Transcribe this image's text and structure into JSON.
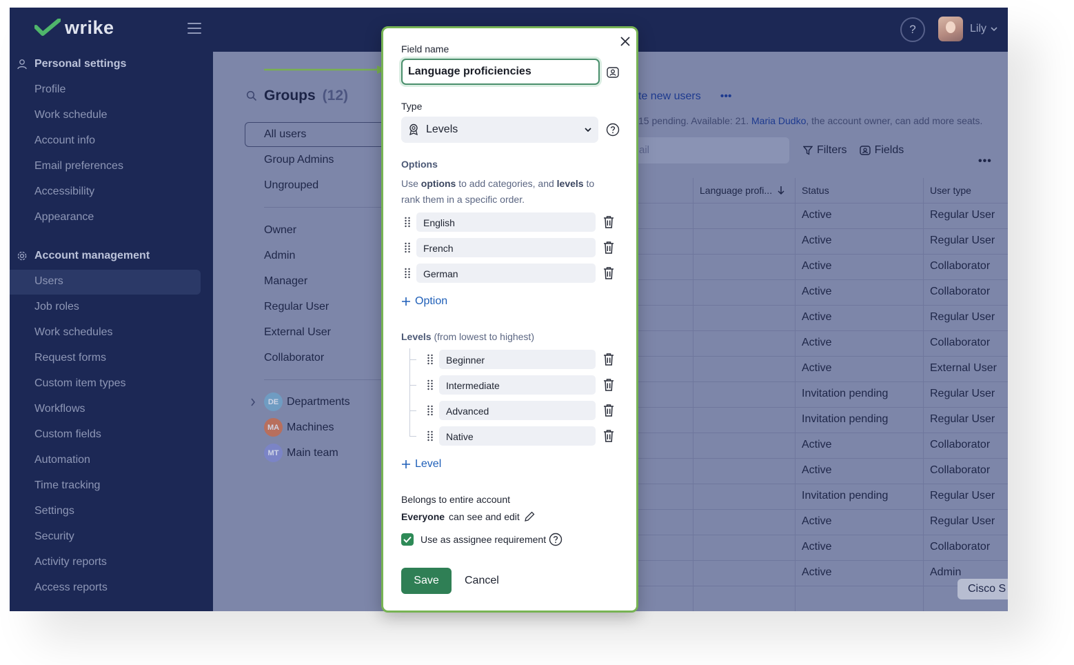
{
  "brand": {
    "name": "wrike"
  },
  "topbar": {
    "user_name": "Lily",
    "help": "?"
  },
  "sidebar": {
    "personal_header": "Personal settings",
    "personal_items": [
      "Profile",
      "Work schedule",
      "Account info",
      "Email preferences",
      "Accessibility",
      "Appearance"
    ],
    "account_header": "Account management",
    "account_items": [
      "Users",
      "Job roles",
      "Work schedules",
      "Request forms",
      "Custom item types",
      "Workflows",
      "Custom fields",
      "Automation",
      "Time tracking",
      "Settings",
      "Security",
      "Activity reports",
      "Access reports"
    ]
  },
  "groups": {
    "title": "Groups",
    "count": "(12)",
    "items": [
      "All users",
      "Group Admins",
      "Ungrouped"
    ],
    "roles": [
      "Owner",
      "Admin",
      "Manager",
      "Regular User",
      "External User",
      "Collaborator"
    ],
    "teams": [
      {
        "initials": "DE",
        "name": "Departments",
        "color": "#6f9cc2"
      },
      {
        "initials": "MA",
        "name": "Machines",
        "color": "#b86f5d"
      },
      {
        "initials": "MT",
        "name": "Main team",
        "color": "#7b84c6"
      }
    ]
  },
  "users_header": {
    "invite_text": "te new users",
    "more": "•••",
    "seats_prefix": "15 pending. Available: 21.",
    "seats_owner": "Maria Dudko",
    "seats_suffix": ", the account owner, can add more seats.",
    "search_tail": "ail",
    "filters": "Filters",
    "fields": "Fields",
    "row_more": "•••"
  },
  "table": {
    "headers": [
      "Language profi...",
      "Status",
      "User type"
    ],
    "rows": [
      [
        "Active",
        "Regular User"
      ],
      [
        "Active",
        "Regular User"
      ],
      [
        "Active",
        "Collaborator"
      ],
      [
        "Active",
        "Collaborator"
      ],
      [
        "Active",
        "Regular User"
      ],
      [
        "Active",
        "Collaborator"
      ],
      [
        "Active",
        "External User"
      ],
      [
        "Invitation pending",
        "Regular User"
      ],
      [
        "Invitation pending",
        "Regular User"
      ],
      [
        "Active",
        "Collaborator"
      ],
      [
        "Active",
        "Collaborator"
      ],
      [
        "Invitation pending",
        "Regular User"
      ],
      [
        "Active",
        "Regular User"
      ],
      [
        "Active",
        "Collaborator"
      ],
      [
        "Active",
        "Admin"
      ]
    ]
  },
  "cisco_tab": "Cisco S",
  "modal": {
    "field_name_label": "Field name",
    "field_name_value": "Language proficiencies",
    "type_label": "Type",
    "type_value": "Levels",
    "options_title": "Options",
    "options_desc": {
      "t1": "Use ",
      "b1": "options",
      "t2": " to add categories, and ",
      "b2": "levels",
      "t3": " to rank them in a specific order."
    },
    "options": [
      "English",
      "French",
      "German"
    ],
    "add_option": "Option",
    "levels_title": "Levels",
    "levels_note": " (from lowest to highest)",
    "levels": [
      "Beginner",
      "Intermediate",
      "Advanced",
      "Native"
    ],
    "add_level": "Level",
    "belongs": "Belongs to entire account",
    "everyone_bold": "Everyone",
    "everyone_rest": "can see and edit",
    "assignee": "Use as assignee requirement",
    "assignee_checked": true,
    "save": "Save",
    "cancel": "Cancel"
  },
  "colors": {
    "accent_green": "#2f7f55",
    "highlight_border": "#77b354",
    "nav_bg": "#1c2855",
    "link": "#1f5fb8"
  }
}
